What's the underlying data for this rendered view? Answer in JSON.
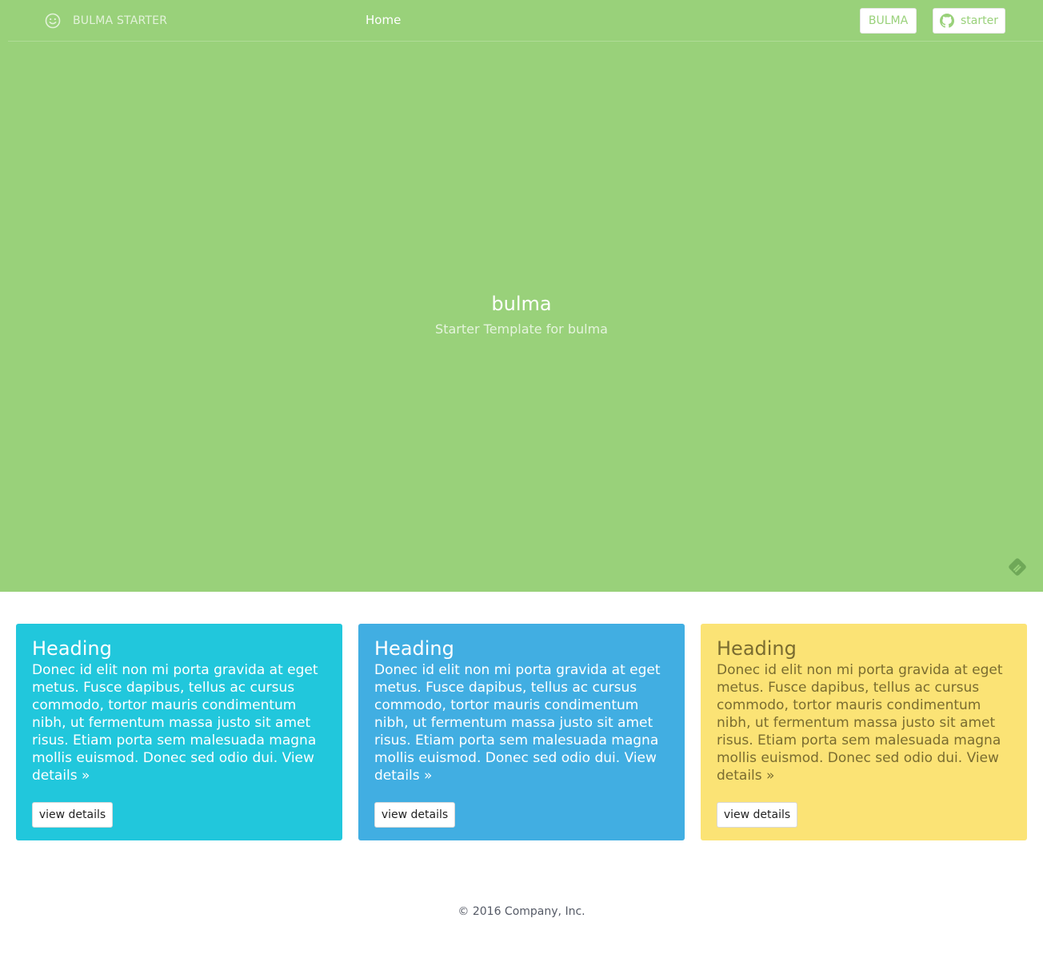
{
  "colors": {
    "hero_bg": "#99d17a",
    "card_1": "#21c7dc",
    "card_2": "#41aee2",
    "card_3": "#fbe375"
  },
  "nav": {
    "brand_icon": "smiley-icon",
    "brand_label": "BULMA STARTER",
    "home_label": "Home",
    "bulma_button": "BULMA",
    "starter_icon": "github-icon",
    "starter_button": "starter"
  },
  "hero": {
    "title": "bulma",
    "subtitle": "Starter Template for bulma",
    "corner_icon": "feedly-icon"
  },
  "cards": [
    {
      "heading": "Heading",
      "text": "Donec id elit non mi porta gravida at eget metus. Fusce dapibus, tellus ac cursus commodo, tortor mauris condimentum nibh, ut fermentum massa justo sit amet risus. Etiam porta sem malesuada magna mollis euismod. Donec sed odio dui. View details »",
      "button": "view details"
    },
    {
      "heading": "Heading",
      "text": "Donec id elit non mi porta gravida at eget metus. Fusce dapibus, tellus ac cursus commodo, tortor mauris condimentum nibh, ut fermentum massa justo sit amet risus. Etiam porta sem malesuada magna mollis euismod. Donec sed odio dui. View details »",
      "button": "view details"
    },
    {
      "heading": "Heading",
      "text": "Donec id elit non mi porta gravida at eget metus. Fusce dapibus, tellus ac cursus commodo, tortor mauris condimentum nibh, ut fermentum massa justo sit amet risus. Etiam porta sem malesuada magna mollis euismod. Donec sed odio dui. View details »",
      "button": "view details"
    }
  ],
  "footer": {
    "text": "© 2016 Company, Inc."
  }
}
